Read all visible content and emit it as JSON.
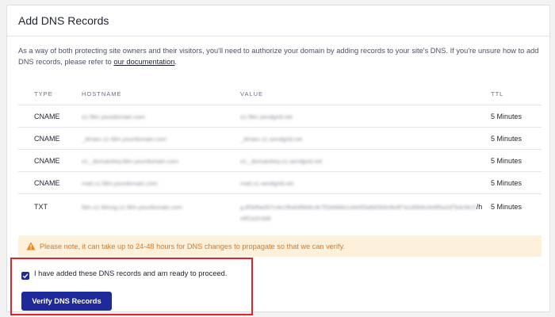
{
  "header": {
    "title": "Add DNS Records"
  },
  "intro": {
    "text": "As a way of both protecting site owners and their visitors, you'll need to authorize your domain by adding records to your site's DNS. If you're unsure how to add DNS records, please refer to ",
    "link": "our documentation",
    "suffix": "."
  },
  "table": {
    "columns": [
      "TYPE",
      "HOSTNAME",
      "VALUE",
      "TTL"
    ],
    "rows": [
      {
        "type": "CNAME",
        "hostname": "s1.fdm.yourdomain.com",
        "value": "s1.fdm.sendgrid.net",
        "ttl": "5 Minutes"
      },
      {
        "type": "CNAME",
        "hostname": "_dmarc.s1.fdm.yourdomain.com",
        "value": "_dmarc.s1.sendgrid.net",
        "ttl": "5 Minutes"
      },
      {
        "type": "CNAME",
        "hostname": "s1._domainkey.fdm.yourdomain.com",
        "value": "s1._domainkey.s1.sendgrid.net",
        "ttl": "5 Minutes"
      },
      {
        "type": "CNAME",
        "hostname": "mail.s1.fdm.yourdomain.com",
        "value": "mail.s1.sendgrid.net",
        "ttl": "5 Minutes"
      },
      {
        "type": "TXT",
        "hostname": "fdm.s1.fdmsg.s1.fdm.yourdomain.com",
        "value": "g.8f3d9a2b7c4e1f6a0d5b8c3e7f2a9d4b1c6e0f3a8d2b5c9e4f7a1d3b6c0e8f5a2d7b4c9e1f",
        "value2": "s8f1a2c3d4",
        "value_suffix": "/h",
        "ttl": "5 Minutes"
      }
    ]
  },
  "notice": {
    "icon": "warning-triangle-icon",
    "text": "Please note, it can take up to 24-48 hours for DNS changes to propagate so that we can verify.",
    "color": "#d9771f",
    "background": "#fdf1dc"
  },
  "confirm": {
    "checkbox_checked": true,
    "label": "I have added these DNS records and am ready to proceed.",
    "button": "Verify DNS Records",
    "highlight_color": "#e2232a",
    "accent_color": "#1f2a9a"
  }
}
